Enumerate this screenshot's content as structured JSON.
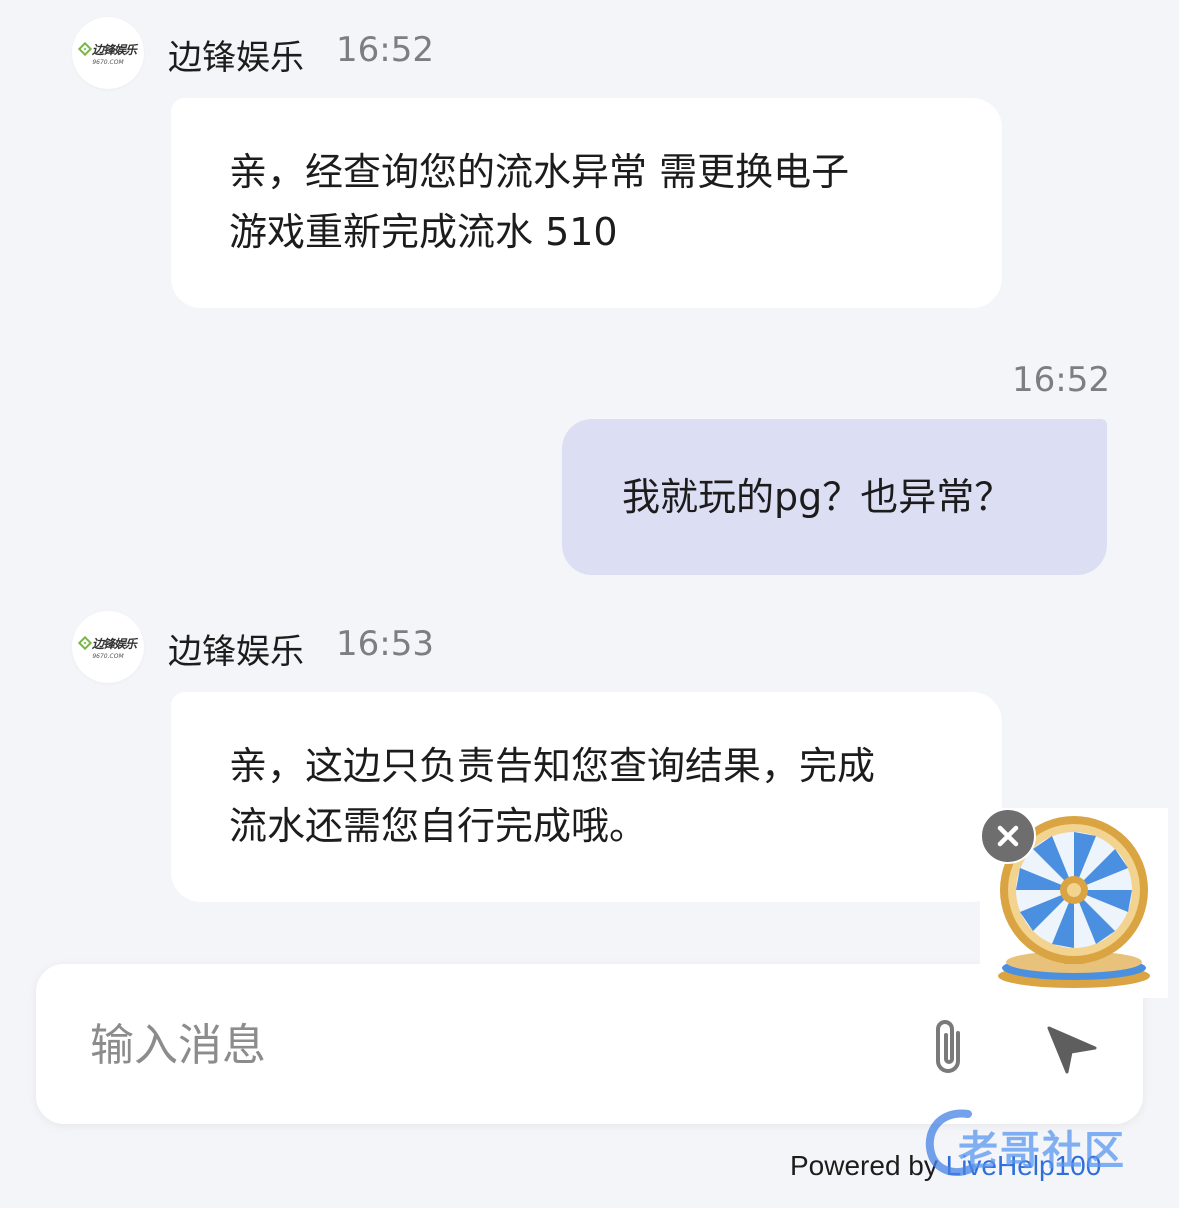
{
  "messages": [
    {
      "type": "incoming",
      "sender": "边锋娱乐",
      "time": "16:52",
      "lines": [
        "亲，经查询您的流水异常 需更换电子",
        "游戏重新完成流水 510"
      ]
    },
    {
      "type": "outgoing",
      "time": "16:52",
      "lines": [
        "我就玩的pg？也异常？"
      ]
    },
    {
      "type": "incoming",
      "sender": "边锋娱乐",
      "time": "16:53",
      "lines": [
        "亲，这边只负责告知您查询结果，完成",
        "流水还需您自行完成哦。"
      ]
    }
  ],
  "avatar": {
    "logo_text": "边锋娱乐",
    "logo_sub": "9670.COM"
  },
  "composer": {
    "placeholder": "输入消息",
    "attach_icon": "paperclip-icon",
    "send_icon": "send-icon"
  },
  "footer": {
    "powered_prefix": "Powered by ",
    "powered_brand": "LiveHelp100"
  },
  "watermark": {
    "text": "老哥社区"
  },
  "colors": {
    "background": "#f4f5f8",
    "incoming_bubble": "#ffffff",
    "outgoing_bubble": "#dcdff3",
    "timestamp": "#7d7d84",
    "brand_green": "#7ab648",
    "wheel_blue": "#4a8fe0",
    "wheel_gold": "#d9a441"
  }
}
